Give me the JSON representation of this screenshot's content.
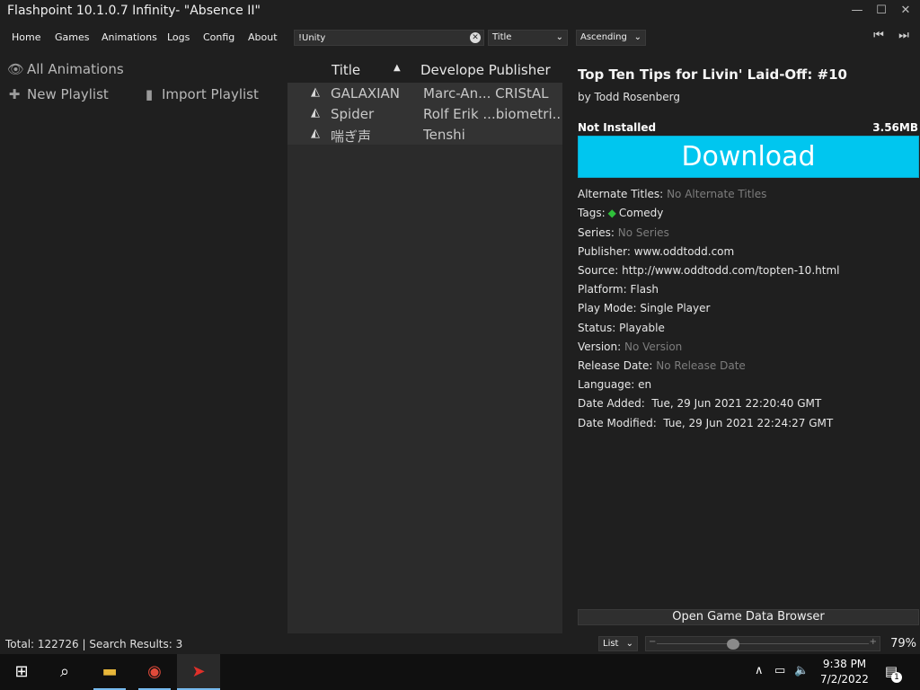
{
  "window": {
    "title": "Flashpoint 10.1.0.7 Infinity- \"Absence II\"",
    "minimize_glyph": "—",
    "maximize_glyph": "☐",
    "close_glyph": "✕"
  },
  "menu": {
    "items": [
      "Home",
      "Games",
      "Animations",
      "Logs",
      "Config",
      "About"
    ],
    "search_value": "!Unity",
    "search_clear": "✕",
    "sort_field": "Title",
    "sort_order": "Ascending",
    "chevron": "⌄",
    "nav_prev": "⏮",
    "nav_next": "⏭"
  },
  "sidebar": {
    "all_animations": "All Animations",
    "new_playlist": "New Playlist",
    "import_playlist": "Import Playlist",
    "eye_glyph": "👁",
    "plus_glyph": "✚",
    "file_glyph": "▮"
  },
  "list": {
    "col_title": "Title",
    "col_dev": "Develope Publisher",
    "sort_glyph": "▲",
    "row_icon": "◭",
    "rows": [
      {
        "title": "GALAXIAN",
        "dev": "Marc-An... CRIStAL"
      },
      {
        "title": "Spider",
        "dev": "Rolf Erik ...biometri..."
      },
      {
        "title": "喘ぎ声",
        "dev": "Tenshi"
      }
    ]
  },
  "detail": {
    "title": "Top Ten Tips for Livin' Laid-Off: #10",
    "by": "by Todd Rosenberg",
    "status": "Not Installed",
    "size": "3.56MB",
    "download": "Download",
    "fields": {
      "alt_label": "Alternate Titles:",
      "alt_value": "No Alternate Titles",
      "tags_label": "Tags:",
      "tags_value": "Comedy",
      "tag_glyph": "◆",
      "series_label": "Series:",
      "series_value": "No Series",
      "publisher_label": "Publisher:",
      "publisher_value": "www.oddtodd.com",
      "source_label": "Source:",
      "source_value": "http://www.oddtodd.com/topten-10.html",
      "platform_label": "Platform:",
      "platform_value": "Flash",
      "playmode_label": "Play Mode:",
      "playmode_value": "Single Player",
      "status_label": "Status:",
      "status_value": "Playable",
      "version_label": "Version:",
      "version_value": "No Version",
      "release_label": "Release Date:",
      "release_value": "No Release Date",
      "language_label": "Language:",
      "language_value": "en",
      "added_label": "Date Added:",
      "added_value": "Tue, 29 Jun 2021 22:20:40 GMT",
      "modified_label": "Date Modified:",
      "modified_value": "Tue, 29 Jun 2021 22:24:27 GMT"
    },
    "browser_button": "Open Game Data Browser"
  },
  "status": {
    "summary": "Total: 122726 | Search Results: 3",
    "view_mode": "List",
    "zoom": "79%",
    "zoom_level": 0.36,
    "minus": "−",
    "plus": "+"
  },
  "taskbar": {
    "start_glyph": "⊞",
    "search_glyph": "⌕",
    "explorer_glyph": "▬",
    "chrome_glyph": "◉",
    "flashpoint_glyph": "➤",
    "tray_up": "∧",
    "network_glyph": "▭",
    "volume_glyph": "🔈",
    "time": "9:38 PM",
    "date": "7/2/2022",
    "notif_glyph": "▤",
    "notif_count": "1"
  }
}
